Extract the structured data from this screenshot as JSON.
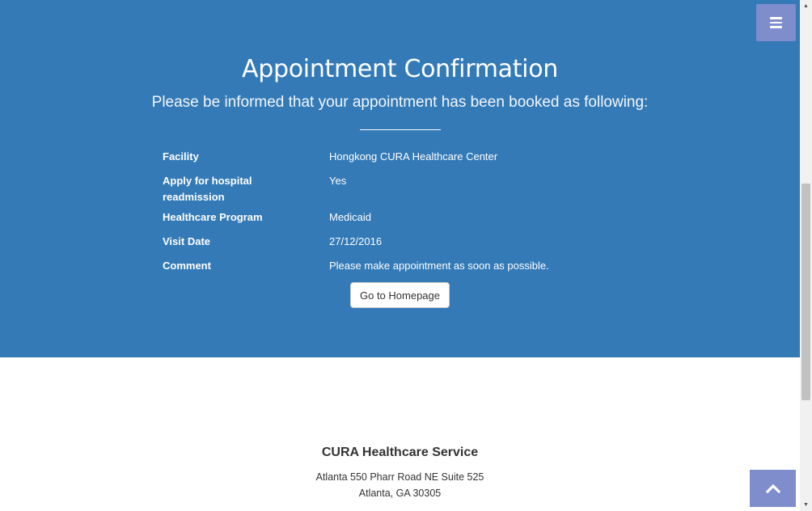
{
  "hero": {
    "title": "Appointment Confirmation",
    "subtitle": "Please be informed that your appointment has been booked as following:"
  },
  "details": [
    {
      "label": "Facility",
      "value": "Hongkong CURA Healthcare Center"
    },
    {
      "label": "Apply for hospital readmission",
      "value": "Yes"
    },
    {
      "label": "Healthcare Program",
      "value": "Medicaid"
    },
    {
      "label": "Visit Date",
      "value": "27/12/2016"
    },
    {
      "label": "Comment",
      "value": "Please make appointment as soon as possible."
    }
  ],
  "home_button_label": "Go to Homepage",
  "footer": {
    "title": "CURA Healthcare Service",
    "address_line1": "Atlanta 550 Pharr Road NE Suite 525",
    "address_line2": "Atlanta, GA 30305"
  },
  "icons": {
    "menu": "bars-icon",
    "to_top": "chevron-up-icon",
    "scroll_up": "triangle-up-icon",
    "scroll_down": "triangle-down-icon"
  },
  "colors": {
    "hero_background": "#337ab7",
    "toggle_background": "#7f8dcd",
    "text_on_hero": "#ffffff"
  }
}
